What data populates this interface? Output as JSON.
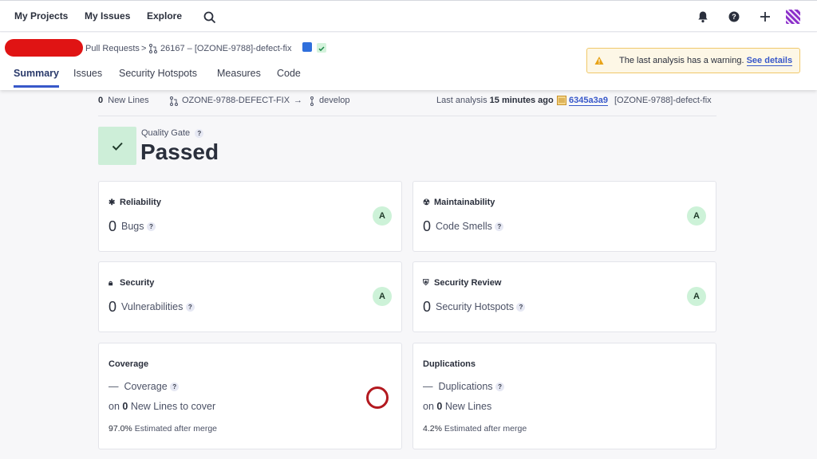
{
  "topnav": {
    "my_projects": "My Projects",
    "my_issues": "My Issues",
    "explore": "Explore"
  },
  "breadcrumb": {
    "pull_requests": "Pull Requests",
    "separator": ">",
    "pr_title": "26167 – [OZONE-9788]-defect-fix"
  },
  "tabs": [
    "Summary",
    "Issues",
    "Security Hotspots",
    "Measures",
    "Code"
  ],
  "warning": {
    "icon": "warning-icon",
    "text": "The last analysis has a warning.",
    "link": "See details",
    "color": "#f0c86a"
  },
  "info": {
    "new_lines_count": "0",
    "new_lines_label": "New Lines",
    "source_branch": "OZONE-9788-DEFECT-FIX",
    "arrow": "→",
    "target_branch": "develop",
    "last_analysis_label": "Last analysis",
    "last_analysis_time": "15 minutes ago",
    "commit_hash": "6345a3a9",
    "commit_message": "[OZONE-9788]-defect-fix"
  },
  "quality_gate": {
    "label": "Quality Gate",
    "help": "?",
    "status": "Passed",
    "color": "#cdeed8"
  },
  "cards": {
    "reliability": {
      "title": "Reliability",
      "value": "0",
      "metric": "Bugs",
      "rating": "A"
    },
    "maintainability": {
      "title": "Maintainability",
      "value": "0",
      "metric": "Code Smells",
      "rating": "A"
    },
    "security": {
      "title": "Security",
      "value": "0",
      "metric": "Vulnerabilities",
      "rating": "A"
    },
    "security_review": {
      "title": "Security Review",
      "value": "0",
      "metric": "Security Hotspots",
      "rating": "A"
    },
    "coverage": {
      "title": "Coverage",
      "dash": "—",
      "metric": "Coverage",
      "on": "on",
      "lines_count": "0",
      "lines_label": "New Lines to cover",
      "estimate_value": "97.0%",
      "estimate_label": "Estimated after merge"
    },
    "duplications": {
      "title": "Duplications",
      "dash": "—",
      "metric": "Duplications",
      "on": "on",
      "lines_count": "0",
      "lines_label": "New Lines",
      "estimate_value": "4.2%",
      "estimate_label": "Estimated after merge"
    }
  },
  "help_mark": "?",
  "accent_color": "#3858c9",
  "rating_color": "#cdf2d8"
}
